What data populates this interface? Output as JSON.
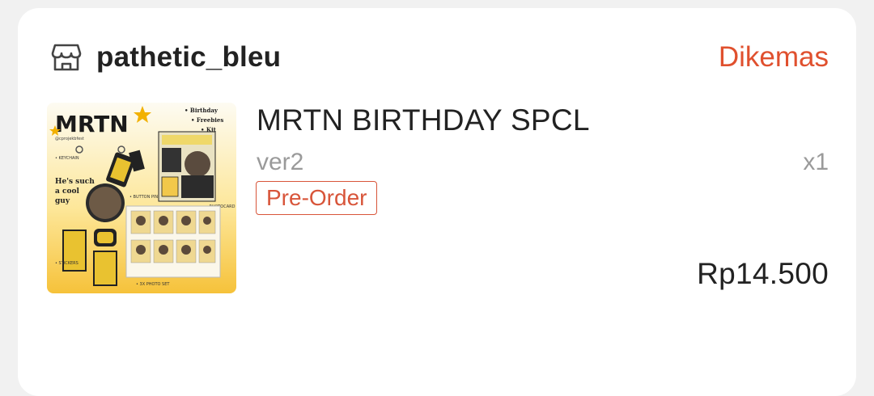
{
  "order": {
    "shop_name": "pathetic_bleu",
    "shop_icon": "store-icon",
    "status": "Dikemas",
    "status_color": "#e0502e",
    "product": {
      "name": "MRTN BIRTHDAY SPCL",
      "variant": "ver2",
      "quantity": "x1",
      "badge": "Pre-Order",
      "price": "Rp14.500",
      "thumbnail": {
        "title": "MRTN",
        "bullets": [
          "• Birthday",
          "• Freebies",
          "• Kit"
        ],
        "tagline": [
          "He's such",
          "a cool",
          "guy"
        ]
      }
    }
  }
}
